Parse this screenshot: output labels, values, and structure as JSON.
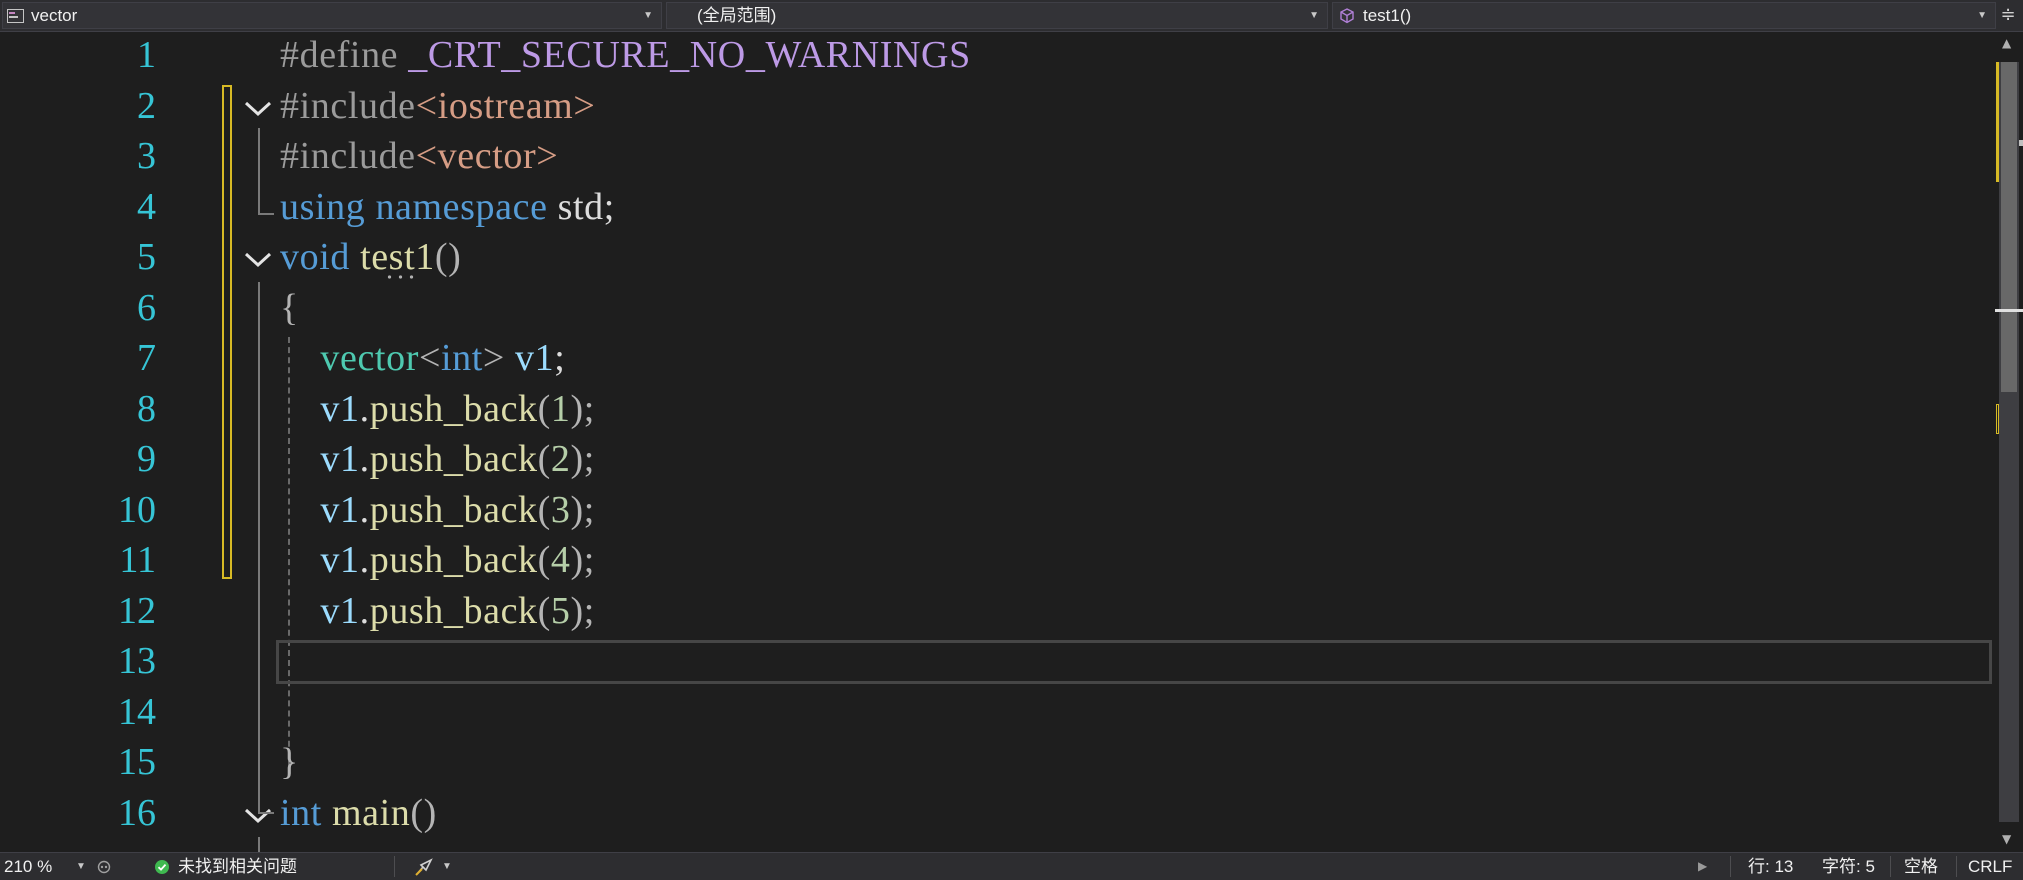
{
  "navbar": {
    "project": "vector",
    "scope": "(全局范围)",
    "member": "test1()",
    "split_icon": "split-window-icon"
  },
  "editor": {
    "line_numbers": [
      "1",
      "2",
      "3",
      "4",
      "5",
      "6",
      "7",
      "8",
      "9",
      "10",
      "11",
      "12",
      "13",
      "14",
      "15",
      "16"
    ],
    "lines": [
      [
        {
          "t": "#define ",
          "c": "pp"
        },
        {
          "t": "_CRT_SECURE_NO_WARNINGS",
          "c": "macro"
        }
      ],
      [
        {
          "t": "#include",
          "c": "pp"
        },
        {
          "t": "<iostream>",
          "c": "str"
        }
      ],
      [
        {
          "t": "#include",
          "c": "pp"
        },
        {
          "t": "<vector>",
          "c": "str"
        }
      ],
      [
        {
          "t": "using ",
          "c": "kw"
        },
        {
          "t": "namespace ",
          "c": "kw"
        },
        {
          "t": "std;",
          "c": "plain"
        }
      ],
      [
        {
          "t": "void ",
          "c": "kw"
        },
        {
          "t": "test1",
          "c": "fn"
        },
        {
          "t": "()",
          "c": "punc"
        }
      ],
      [
        {
          "t": "{",
          "c": "punc"
        }
      ],
      [
        {
          "t": "    vector",
          "c": "type"
        },
        {
          "t": "<",
          "c": "punc"
        },
        {
          "t": "int",
          "c": "kw"
        },
        {
          "t": "> ",
          "c": "punc"
        },
        {
          "t": "v1",
          "c": "var"
        },
        {
          "t": ";",
          "c": "plain"
        }
      ],
      [
        {
          "t": "    v1",
          "c": "var"
        },
        {
          "t": ".",
          "c": "plain"
        },
        {
          "t": "push_back",
          "c": "fn"
        },
        {
          "t": "(",
          "c": "punc"
        },
        {
          "t": "1",
          "c": "num"
        },
        {
          "t": ");",
          "c": "punc"
        }
      ],
      [
        {
          "t": "    v1",
          "c": "var"
        },
        {
          "t": ".",
          "c": "plain"
        },
        {
          "t": "push_back",
          "c": "fn"
        },
        {
          "t": "(",
          "c": "punc"
        },
        {
          "t": "2",
          "c": "num"
        },
        {
          "t": ");",
          "c": "punc"
        }
      ],
      [
        {
          "t": "    v1",
          "c": "var"
        },
        {
          "t": ".",
          "c": "plain"
        },
        {
          "t": "push_back",
          "c": "fn"
        },
        {
          "t": "(",
          "c": "punc"
        },
        {
          "t": "3",
          "c": "num"
        },
        {
          "t": ");",
          "c": "punc"
        }
      ],
      [
        {
          "t": "    v1",
          "c": "var"
        },
        {
          "t": ".",
          "c": "plain"
        },
        {
          "t": "push_back",
          "c": "fn"
        },
        {
          "t": "(",
          "c": "punc"
        },
        {
          "t": "4",
          "c": "num"
        },
        {
          "t": ");",
          "c": "punc"
        }
      ],
      [
        {
          "t": "    v1",
          "c": "var"
        },
        {
          "t": ".",
          "c": "plain"
        },
        {
          "t": "push_back",
          "c": "fn"
        },
        {
          "t": "(",
          "c": "punc"
        },
        {
          "t": "5",
          "c": "num"
        },
        {
          "t": ");",
          "c": "punc"
        }
      ],
      [],
      [],
      [
        {
          "t": "}",
          "c": "punc"
        }
      ],
      [
        {
          "t": "int ",
          "c": "kw"
        },
        {
          "t": "main",
          "c": "fn"
        },
        {
          "t": "()",
          "c": "punc"
        }
      ]
    ],
    "current_line": 13
  },
  "statusbar": {
    "zoom": "210 %",
    "issues": "未找到相关问题",
    "line": "行: 13",
    "char": "字符: 5",
    "whitespace": "空格",
    "line_ending": "CRLF"
  },
  "colors": {
    "background": "#1e1e1e",
    "line_number": "#36c5d6",
    "keyword": "#569cd6",
    "type": "#4ec9b0",
    "function": "#dcdcaa",
    "string": "#d69d85",
    "macro": "#bd9ae6",
    "change_marker": "#d7ba25",
    "ok_status": "#3fb950"
  }
}
